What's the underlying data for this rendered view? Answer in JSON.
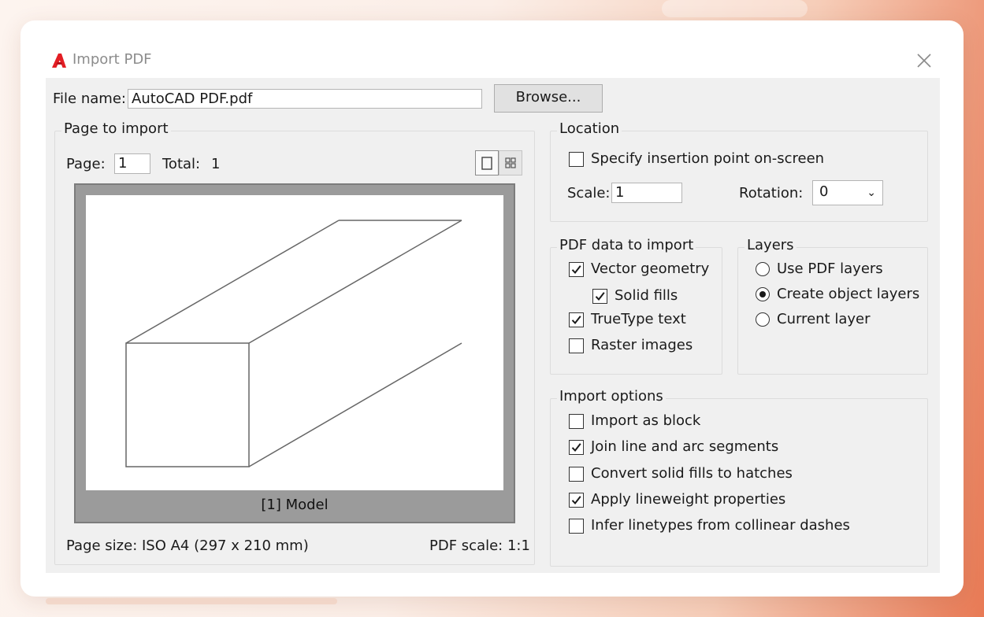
{
  "window": {
    "title": "Import PDF"
  },
  "file": {
    "label": "File name:",
    "value": "AutoCAD  PDF.pdf",
    "browse_label": "Browse..."
  },
  "page_import": {
    "legend": "Page to import",
    "page_label": "Page:",
    "page_value": "1",
    "total_label": "Total:",
    "total_value": "1",
    "preview_label": "[1] Model",
    "page_size": "Page size: ISO A4 (297 x 210 mm)",
    "pdf_scale": "PDF scale: 1:1"
  },
  "location": {
    "legend": "Location",
    "insertion_point": {
      "label": "Specify insertion point on-screen",
      "checked": false
    },
    "scale_label": "Scale:",
    "scale_value": "1",
    "rotation_label": "Rotation:",
    "rotation_value": "0"
  },
  "pdf_data": {
    "legend": "PDF data to import",
    "items": [
      {
        "label": "Vector geometry",
        "checked": true
      },
      {
        "label": "Solid fills",
        "checked": true
      },
      {
        "label": "TrueType text",
        "checked": true
      },
      {
        "label": "Raster images",
        "checked": false
      }
    ]
  },
  "layers": {
    "legend": "Layers",
    "options": [
      {
        "label": "Use PDF layers",
        "selected": false
      },
      {
        "label": "Create object layers",
        "selected": true
      },
      {
        "label": "Current layer",
        "selected": false
      }
    ]
  },
  "import_options": {
    "legend": "Import options",
    "items": [
      {
        "label": "Import as block",
        "checked": false
      },
      {
        "label": "Join line and arc segments",
        "checked": true
      },
      {
        "label": "Convert solid fills to hatches",
        "checked": false
      },
      {
        "label": "Apply lineweight properties",
        "checked": true
      },
      {
        "label": "Infer linetypes from collinear dashes",
        "checked": false
      }
    ]
  },
  "icons": {
    "app": "autocad-logo-icon",
    "close": "close-icon",
    "single_view": "single-page-view-icon",
    "grid_view": "grid-view-icon",
    "dropdown": "chevron-down-icon",
    "check": "checkmark-icon"
  },
  "colors": {
    "brand": "#e31e24",
    "dialog_bg": "#f0f0f0",
    "preview_bg": "#9b9b9b"
  }
}
